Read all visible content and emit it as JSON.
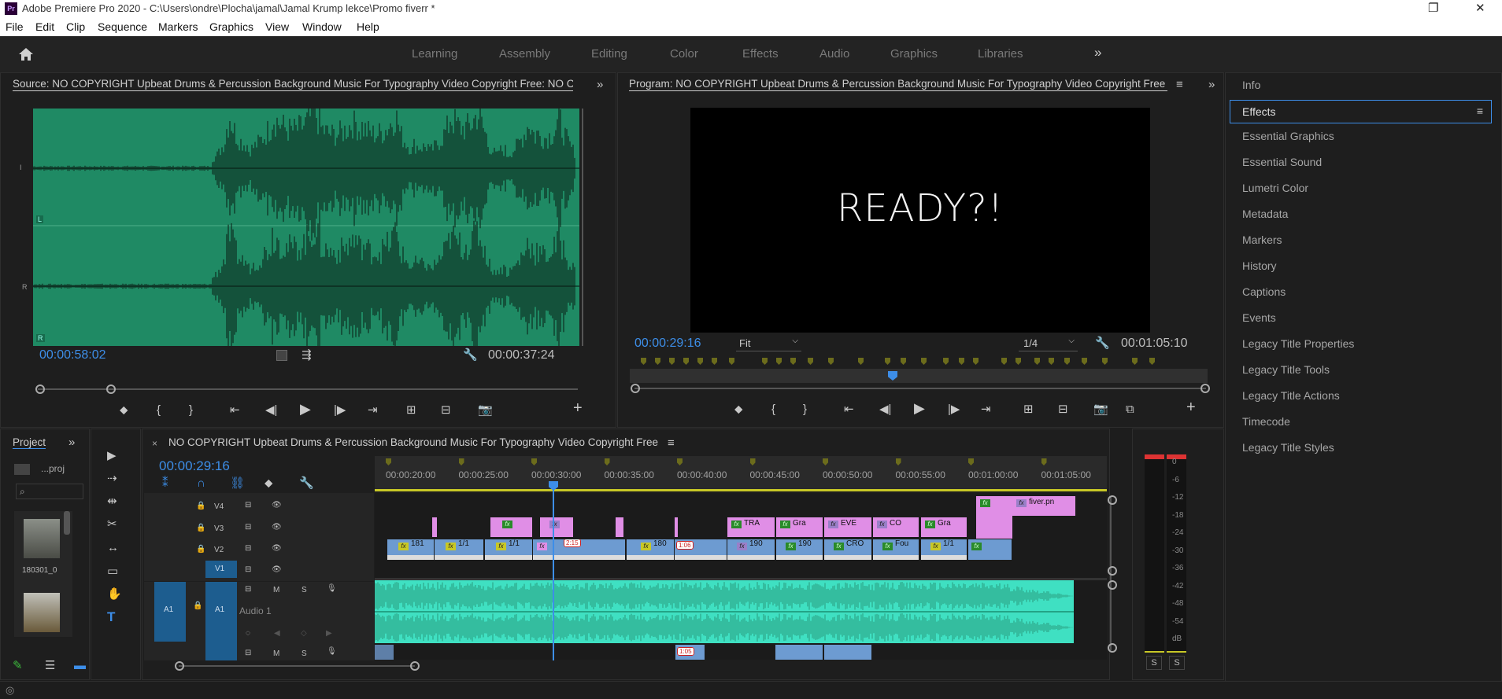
{
  "window": {
    "title": "Adobe Premiere Pro 2020 - C:\\Users\\ondre\\Plocha\\jamal\\Jamal Krump lekce\\Promo fiverr *",
    "logo_text": "Pr",
    "controls": [
      "❐",
      "✕"
    ]
  },
  "menu": [
    "File",
    "Edit",
    "Clip",
    "Sequence",
    "Markers",
    "Graphics",
    "View",
    "Window",
    "Help"
  ],
  "workspaces": {
    "tabs": [
      "Learning",
      "Assembly",
      "Editing",
      "Color",
      "Effects",
      "Audio",
      "Graphics",
      "Libraries"
    ],
    "more": "»"
  },
  "source": {
    "title": "Source: NO COPYRIGHT Upbeat Drums & Percussion Background Music For Typography Video Copyright Free: NO C",
    "timecode_in": "00:00:58:02",
    "timecode_duration": "00:00:37:24",
    "ch_top": "I",
    "ch_bottom": "R",
    "l_tag": "L",
    "r_tag": "R"
  },
  "program": {
    "title": "Program: NO COPYRIGHT Upbeat Drums & Percussion Background Music For Typography Video Copyright Free",
    "preview_text": "READY?!",
    "timecode": "00:00:29:16",
    "fit": "Fit",
    "resolution": "1/4",
    "duration": "00:01:05:10"
  },
  "right_panel": {
    "items": [
      "Info",
      "Effects",
      "Essential Graphics",
      "Essential Sound",
      "Lumetri Color",
      "Metadata",
      "Markers",
      "History",
      "Captions",
      "Events",
      "Legacy Title Properties",
      "Legacy Title Tools",
      "Legacy Title Actions",
      "Timecode",
      "Legacy Title Styles"
    ],
    "active": "Effects"
  },
  "project": {
    "tab": "Project",
    "more": "»",
    "bin_name": "...proj",
    "clip1_name": "180301_0"
  },
  "timeline": {
    "close": "×",
    "title": "NO COPYRIGHT Upbeat Drums & Percussion Background Music For Typography Video Copyright Free",
    "timecode": "00:00:29:16",
    "ruler": [
      "00:00:20:00",
      "00:00:25:00",
      "00:00:30:00",
      "00:00:35:00",
      "00:00:40:00",
      "00:00:45:00",
      "00:00:50:00",
      "00:00:55:00",
      "00:01:00:00",
      "00:01:05:00"
    ],
    "tracks": {
      "v4": "V4",
      "v3": "V3",
      "v2": "V2",
      "v1": "V1",
      "a1": "A1",
      "audio1": "Audio 1"
    },
    "m": "M",
    "s": "S",
    "clips": {
      "v2_1": "TRA",
      "v2_2": "Gra",
      "v2_3": "EVE",
      "v2_4": "CO",
      "v2_5": "Gra",
      "v3_fiverr": "fiver.pn",
      "v1_1": "181",
      "v1_2": "1/1",
      "v1_3": "1/1",
      "v1_4": "180",
      "v1_5": "190",
      "v1_6": "190",
      "v1_7": "CRO",
      "v1_8": "Fou",
      "v1_9": "1/1",
      "badge1": "2:15",
      "badge2": "1:06",
      "badge3": "1:05"
    }
  },
  "meter": {
    "ticks": [
      "0",
      "-6",
      "-12",
      "-18",
      "-24",
      "-30",
      "-36",
      "-42",
      "-48",
      "-54",
      "dB"
    ],
    "solo_labels": [
      "S",
      "S"
    ]
  },
  "colors": {
    "accent_blue": "#3d8ee8",
    "waveform_bg": "#1f8a64",
    "audio_clip": "#3fe0c2",
    "graphic_clip": "#e08ee6",
    "video_clip": "#6d9bd1"
  }
}
